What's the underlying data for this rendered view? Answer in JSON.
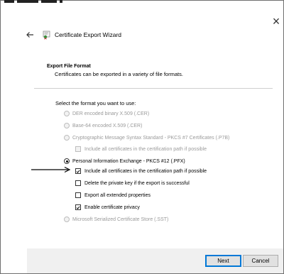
{
  "window": {
    "title": "Certificate Export Wizard",
    "close_glyph": "×"
  },
  "section": {
    "title": "Export File Format",
    "subtitle": "Certificates can be exported in a variety of file formats."
  },
  "prompt": "Select the format you want to use:",
  "options": {
    "der": {
      "label": "DER encoded binary X.509 (.CER)",
      "selected": false,
      "enabled": false
    },
    "base64": {
      "label": "Base-64 encoded X.509 (.CER)",
      "selected": false,
      "enabled": false
    },
    "pkcs7": {
      "label": "Cryptographic Message Syntax Standard - PKCS #7 Certificates (.P7B)",
      "selected": false,
      "enabled": false
    },
    "pkcs7_include_all": {
      "label": "Include all certificates in the certification path if possible",
      "checked": false,
      "enabled": false
    },
    "pfx": {
      "label": "Personal Information Exchange - PKCS #12 (.PFX)",
      "selected": true,
      "enabled": true
    },
    "pfx_include_all": {
      "label": "Include all certificates in the certification path if possible",
      "checked": true,
      "enabled": true
    },
    "pfx_delete_key": {
      "label": "Delete the private key if the export is successful",
      "checked": false,
      "enabled": true
    },
    "pfx_export_props": {
      "label": "Export all extended properties",
      "checked": false,
      "enabled": true
    },
    "pfx_privacy": {
      "label": "Enable certificate privacy",
      "checked": true,
      "enabled": true
    },
    "sst": {
      "label": "Microsoft Serialized Certificate Store (.SST)",
      "selected": false,
      "enabled": false
    }
  },
  "buttons": {
    "next": "Next",
    "cancel": "Cancel"
  },
  "icons": {
    "back": "back-arrow-icon",
    "wizard": "certificate-icon",
    "annotation": "pointer-arrow-icon"
  }
}
